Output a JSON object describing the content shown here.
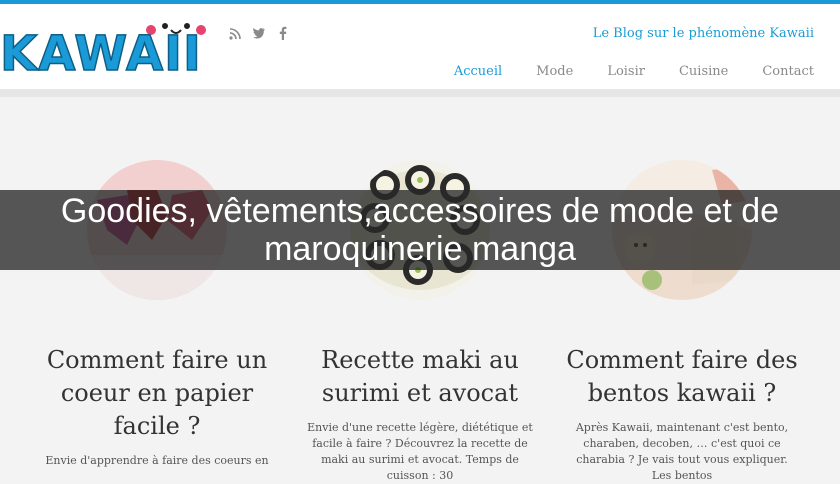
{
  "site": {
    "logo_text": "KAWAII",
    "tagline": "Le Blog sur le phénomène Kawaii",
    "social": [
      {
        "icon": "rss-icon",
        "glyph": "◠"
      },
      {
        "icon": "twitter-icon",
        "glyph": "❦"
      },
      {
        "icon": "facebook-icon",
        "glyph": "f"
      }
    ]
  },
  "nav": {
    "items": [
      {
        "label": "Accueil",
        "active": true
      },
      {
        "label": "Mode",
        "active": false
      },
      {
        "label": "Loisir",
        "active": false
      },
      {
        "label": "Cuisine",
        "active": false
      },
      {
        "label": "Contact",
        "active": false
      }
    ]
  },
  "overlay": {
    "title": "Goodies, vêtements,accessoires de mode et de maroquinerie manga"
  },
  "articles": [
    {
      "title": "Comment faire un coeur en papier facile ?",
      "excerpt": "Envie d'apprendre à faire des coeurs en"
    },
    {
      "title": "Recette maki au surimi et avocat",
      "excerpt": "Envie d'une recette légère, diététique et facile à faire ? Découvrez la recette de maki au surimi et avocat. Temps de cuisson : 30"
    },
    {
      "title": "Comment faire des bentos kawaii ?",
      "excerpt": "Après Kawaii, maintenant c'est bento, charaben, decoben, … c'est quoi ce charabia ? Je vais tout vous expliquer. Les bentos"
    }
  ],
  "colors": {
    "accent": "#1a9bd7",
    "nav_inactive": "#8a8a8a",
    "background": "#f3f3f3"
  }
}
